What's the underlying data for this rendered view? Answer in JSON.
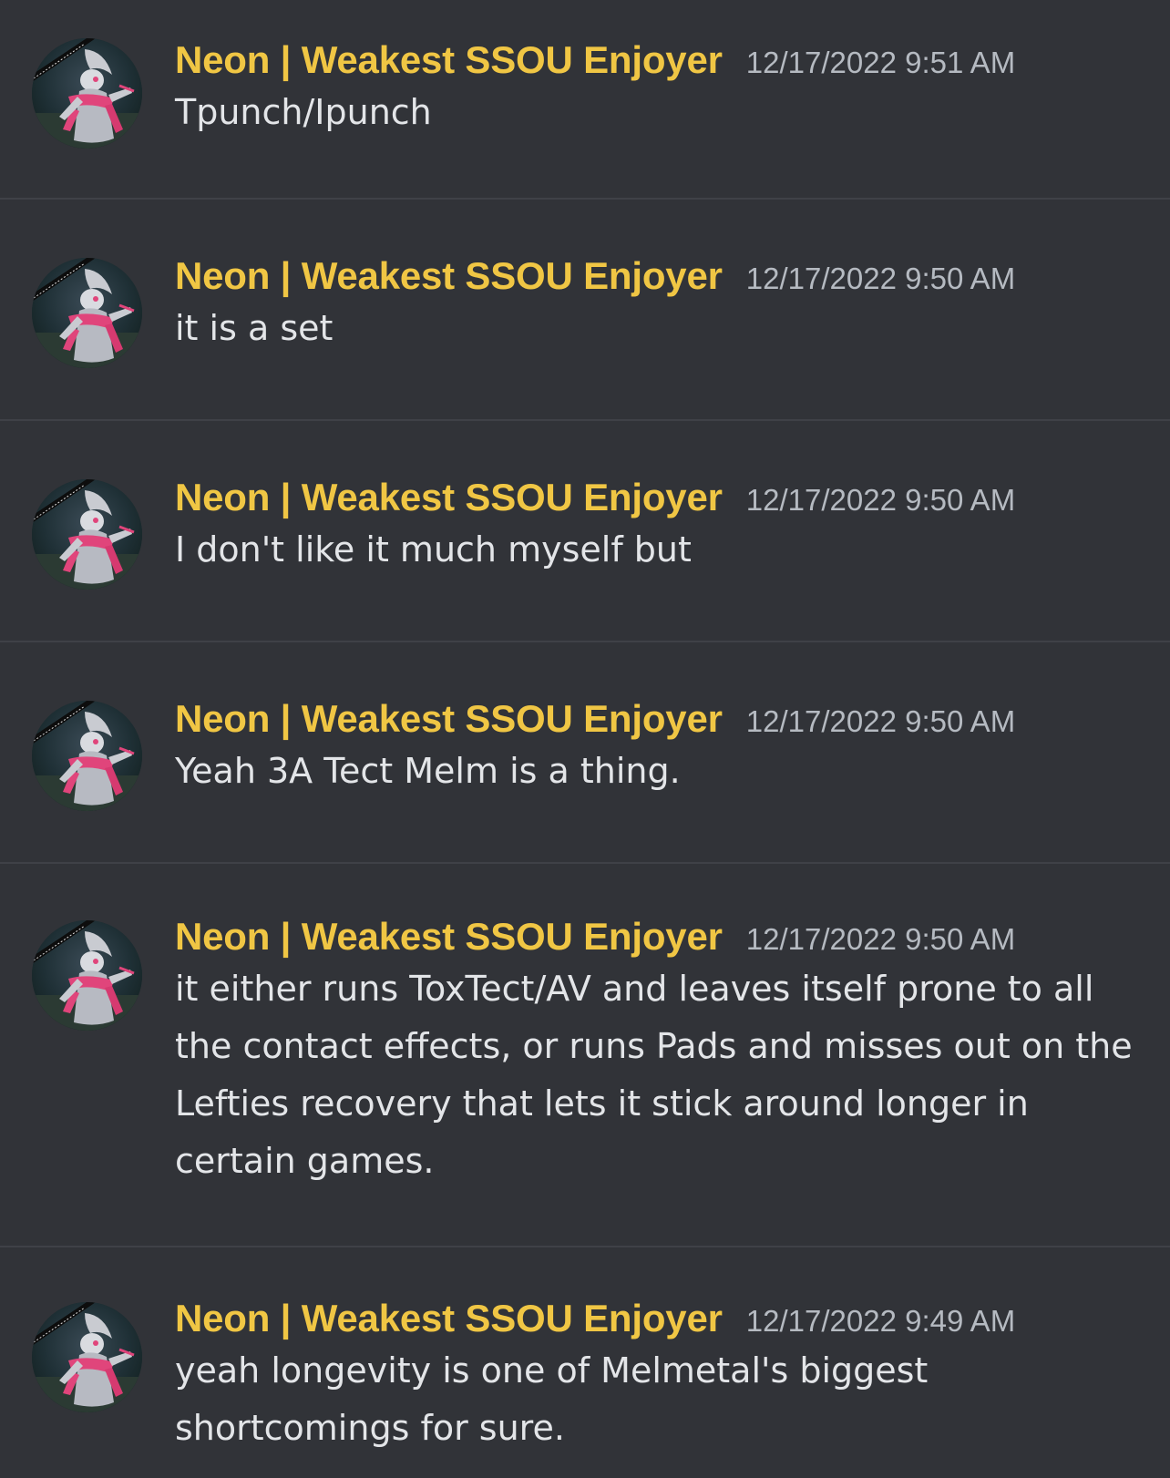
{
  "colors": {
    "background": "#313338",
    "divider": "#3f4147",
    "author": "#f0c644",
    "timestamp": "#b5bac1",
    "text": "#e3e5e8"
  },
  "messages": [
    {
      "author": "Neon | Weakest SSOU Enjoyer",
      "timestamp": "12/17/2022 9:51 AM",
      "text": "Tpunch/Ipunch",
      "avatar_icon": "gardevoir-avatar"
    },
    {
      "author": "Neon | Weakest SSOU Enjoyer",
      "timestamp": "12/17/2022 9:50 AM",
      "text": "it is a set",
      "avatar_icon": "gardevoir-avatar"
    },
    {
      "author": "Neon | Weakest SSOU Enjoyer",
      "timestamp": "12/17/2022 9:50 AM",
      "text": "I don't like it much myself but",
      "avatar_icon": "gardevoir-avatar"
    },
    {
      "author": "Neon | Weakest SSOU Enjoyer",
      "timestamp": "12/17/2022 9:50 AM",
      "text": "Yeah 3A Tect Melm is a thing.",
      "avatar_icon": "gardevoir-avatar"
    },
    {
      "author": "Neon | Weakest SSOU Enjoyer",
      "timestamp": "12/17/2022 9:50 AM",
      "text": "it either runs ToxTect/AV and leaves itself prone to all the contact effects, or runs Pads and misses out on the Lefties recovery that lets it stick around longer in certain games.",
      "avatar_icon": "gardevoir-avatar"
    },
    {
      "author": "Neon | Weakest SSOU Enjoyer",
      "timestamp": "12/17/2022 9:49 AM",
      "text": "yeah longevity is one of Melmetal's biggest shortcomings for sure.",
      "avatar_icon": "gardevoir-avatar"
    }
  ]
}
